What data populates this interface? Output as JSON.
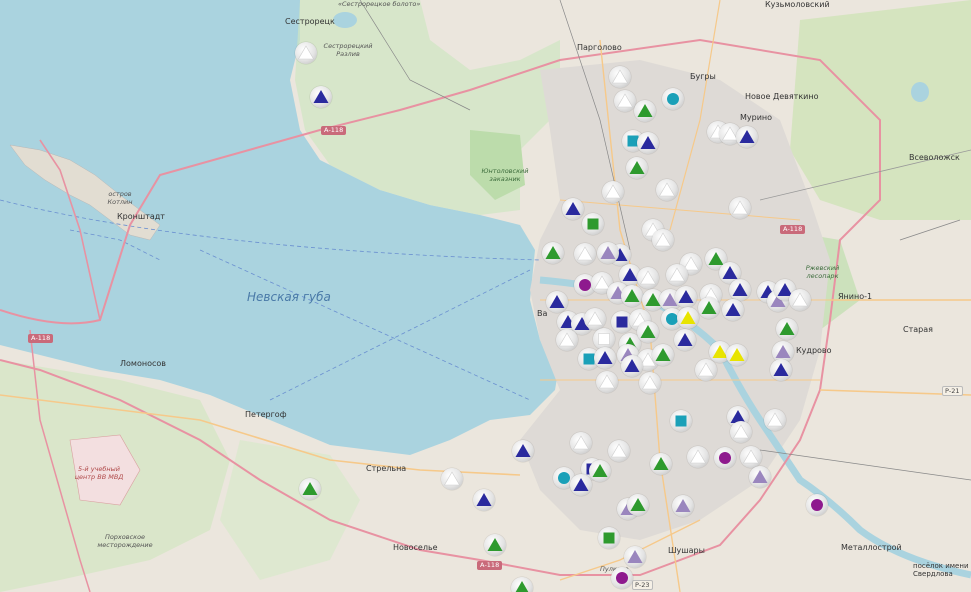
{
  "map": {
    "water_label": "Невская губа",
    "labels": {
      "sestroretsk": "Сестрорецк",
      "sestroretsk_swamp": "«Сестрорецкое болото»",
      "sestroretsk_razliv": "Сестрорецкий Разлив",
      "pargolovo": "Парголово",
      "bugry": "Бугры",
      "kuzmolovsky": "Кузьмоловский",
      "novoe_devyatkino": "Новое Девяткино",
      "murino": "Мурино",
      "vsevolozhsk": "Всеволожск",
      "kotlin": "остров Котлин",
      "kronshtadt": "Кронштадт",
      "yuntolovsky": "Юнтоловский заказник",
      "rzhevsky": "Ржевский лесопарк",
      "yanino": "Янино-1",
      "staraya": "Старая",
      "kudrovo": "Кудрово",
      "lomonosov": "Ломоносов",
      "petergof": "Петергоф",
      "strelna": "Стрельна",
      "uchebny_centr": "5-й учебный центр ВВ МВД",
      "gorelovskoe": "Порховское месторождение",
      "novoselye": "Новоселье",
      "shushary": "Шушары",
      "pulkovo": "Пулково",
      "metallostroy": "Металлострой",
      "sverdlova": "посёлок имени Свердлова",
      "vasilyevsky": "Ва"
    },
    "roads": {
      "a118_north": "А-118",
      "a118_west": "А-118",
      "a118_east": "А-118",
      "a118_south": "А-118",
      "r21": "Р-21",
      "r23": "Р-23"
    },
    "marker_colors": {
      "blue": "#2a2a9e",
      "white": "#ffffff",
      "green": "#2e9a2e",
      "lavender": "#9a86be",
      "teal": "#1aa0b8",
      "purple": "#8e1a8e",
      "yellow": "#e8e400"
    }
  }
}
